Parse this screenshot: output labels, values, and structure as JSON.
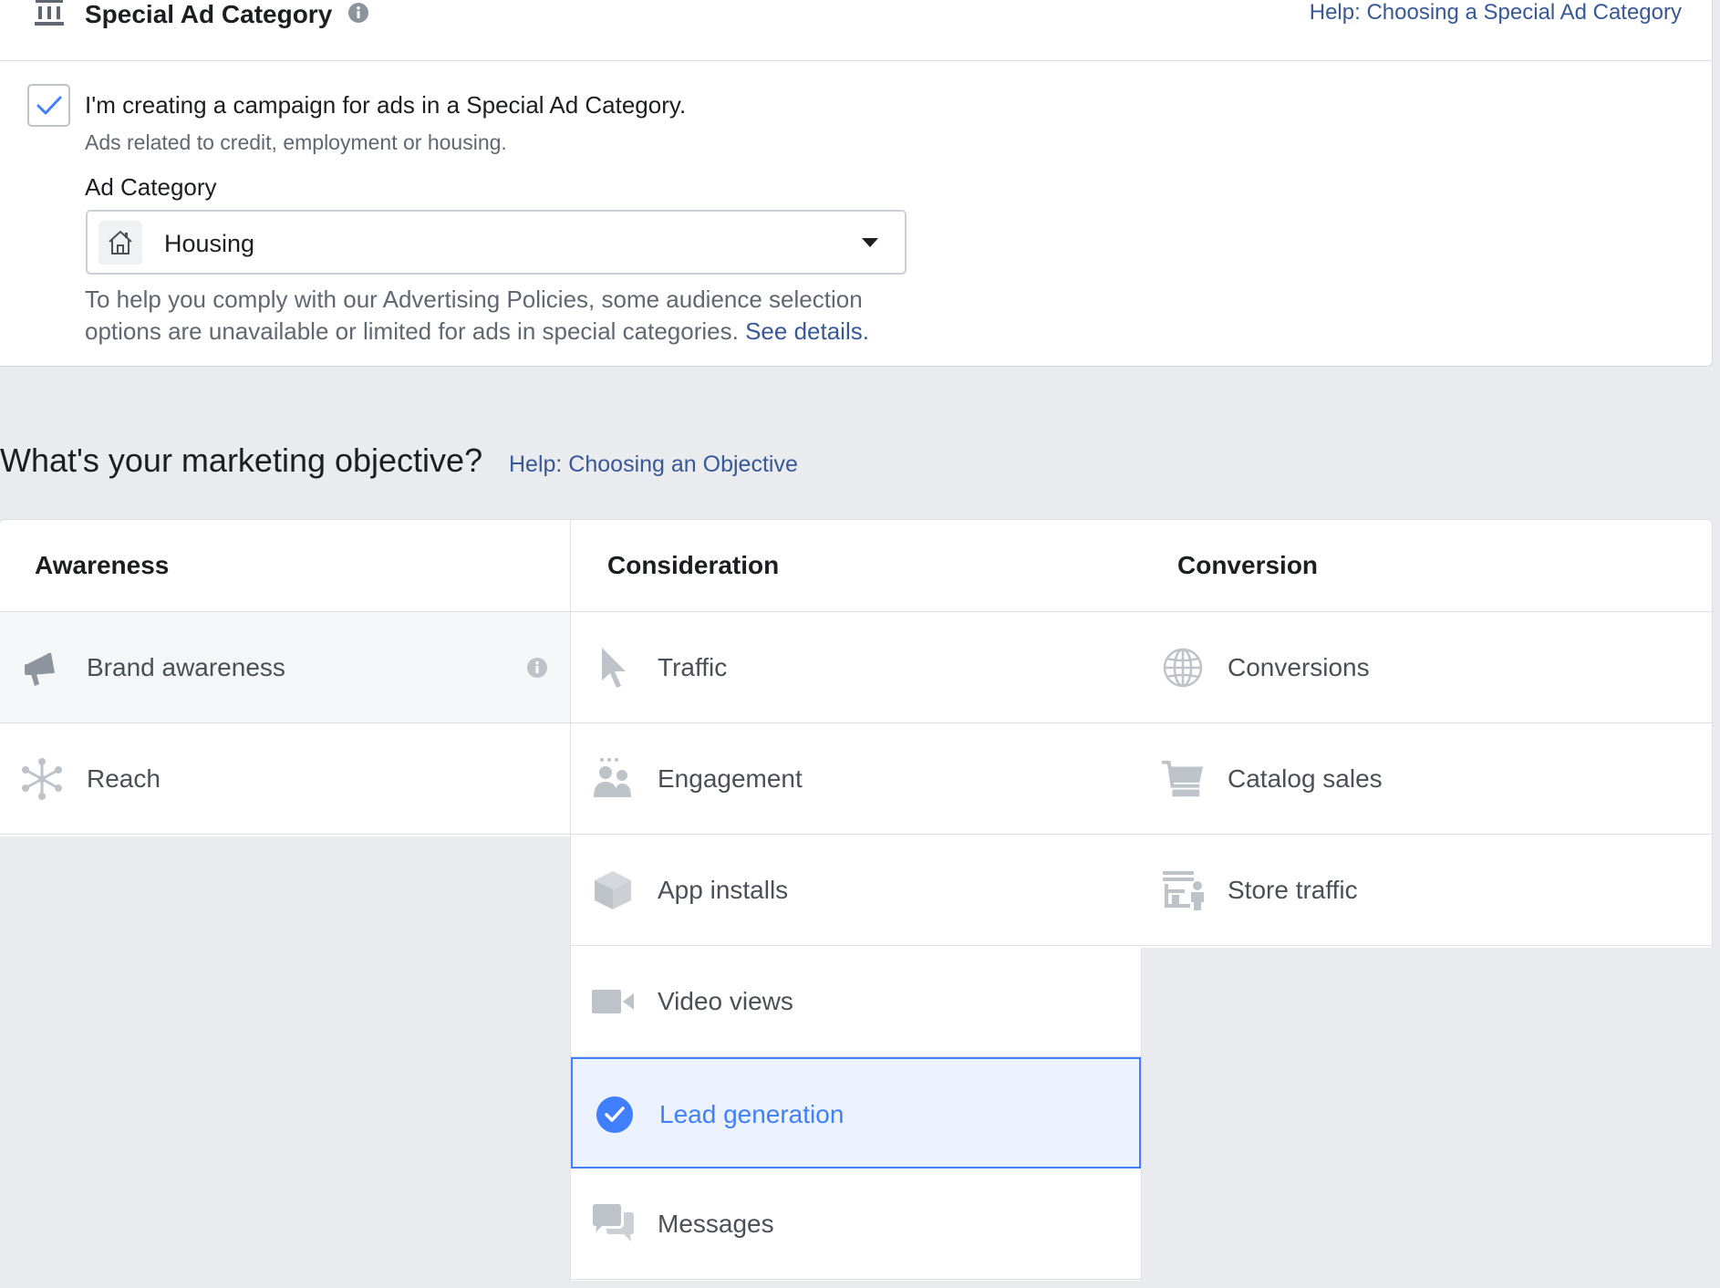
{
  "special_ad_category": {
    "title": "Special Ad Category",
    "help_link": "Help: Choosing a Special Ad Category",
    "checkbox_label": "I'm creating a campaign for ads in a Special Ad Category.",
    "checkbox_checked": true,
    "checkbox_sublabel": "Ads related to credit, employment or housing.",
    "ad_category_label": "Ad Category",
    "ad_category_value": "Housing",
    "note_text": "To help you comply with our Advertising Policies, some audience selection options are unavailable or limited for ads in special categories.",
    "note_link": "See details."
  },
  "objective": {
    "title": "What's your marketing objective?",
    "help_link": "Help: Choosing an Objective",
    "columns": [
      {
        "heading": "Awareness",
        "items": [
          {
            "label": "Brand awareness",
            "icon": "megaphone-icon",
            "state": "hover"
          },
          {
            "label": "Reach",
            "icon": "reach-icon",
            "state": "default"
          }
        ]
      },
      {
        "heading": "Consideration",
        "items": [
          {
            "label": "Traffic",
            "icon": "cursor-icon",
            "state": "default"
          },
          {
            "label": "Engagement",
            "icon": "people-icon",
            "state": "default"
          },
          {
            "label": "App installs",
            "icon": "box-icon",
            "state": "default"
          },
          {
            "label": "Video views",
            "icon": "video-camera-icon",
            "state": "default"
          },
          {
            "label": "Lead generation",
            "icon": "check-circle-icon",
            "state": "selected"
          },
          {
            "label": "Messages",
            "icon": "chat-bubbles-icon",
            "state": "default"
          }
        ]
      },
      {
        "heading": "Conversion",
        "items": [
          {
            "label": "Conversions",
            "icon": "globe-icon",
            "state": "default"
          },
          {
            "label": "Catalog sales",
            "icon": "cart-icon",
            "state": "default"
          },
          {
            "label": "Store traffic",
            "icon": "store-icon",
            "state": "default"
          }
        ]
      }
    ]
  },
  "colors": {
    "link": "#385898",
    "accent": "#4080ff",
    "selected_bg": "#ecf3ff",
    "icon_gray": "#bec3c9",
    "page_bg": "#e9ebee"
  }
}
